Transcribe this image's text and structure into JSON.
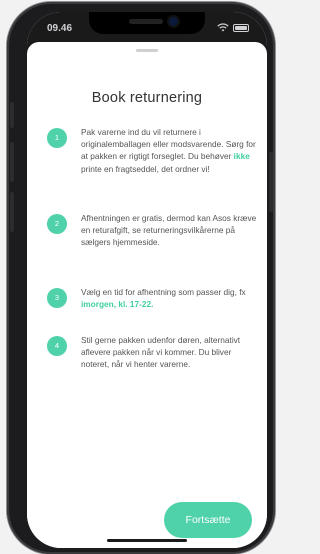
{
  "status_bar": {
    "time": "09.46"
  },
  "sheet": {
    "title": "Book returnering",
    "steps": [
      {
        "number": "1",
        "text_before": "Pak varerne ind du vil returnere i originalemballagen eller modsvarende. Sørg for at pakken er rigtigt forseglet. Du behøver ",
        "highlight": "ikke",
        "text_after": " printe en fragtseddel, det ordner vi!"
      },
      {
        "number": "2",
        "text_before": "Afhentningen er gratis, dermod kan Asos kræve en returafgift, se returneringsvilkårerne på sælgers hjemmeside.",
        "highlight": "",
        "text_after": ""
      },
      {
        "number": "3",
        "text_before": "Vælg en tid for afhentning som passer dig, fx ",
        "highlight": "imorgen, kl. 17-22.",
        "text_after": ""
      },
      {
        "number": "4",
        "text_before": "Stil gerne pakken udenfor døren, alternativt aflevere pakken når vi kommer. Du bliver noteret, når vi henter varerne.",
        "highlight": "",
        "text_after": ""
      }
    ],
    "continue_label": "Fortsætte"
  },
  "colors": {
    "accent": "#4fd1a9",
    "text": "#555555",
    "title": "#333333"
  },
  "icons": {
    "wifi": "wifi-icon",
    "battery": "battery-icon"
  }
}
